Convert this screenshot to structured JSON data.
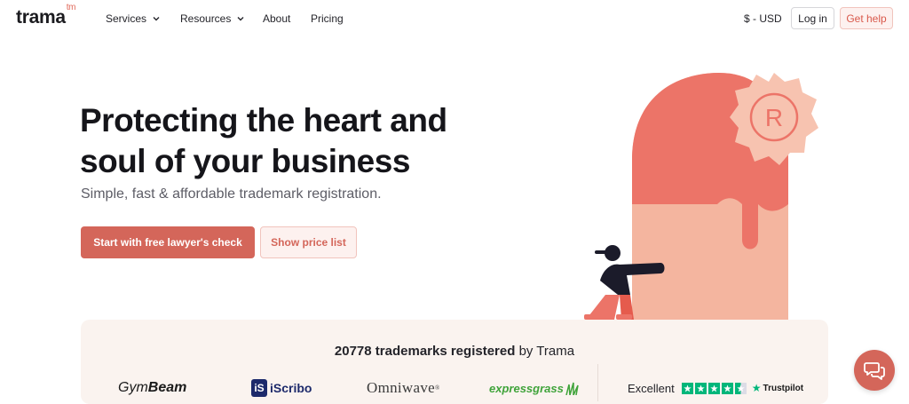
{
  "header": {
    "logo": "trama",
    "logo_sup": "tm",
    "nav": {
      "services": "Services",
      "resources": "Resources",
      "about": "About",
      "pricing": "Pricing"
    },
    "currency": "$ - USD",
    "login_label": "Log in",
    "help_label": "Get help"
  },
  "hero": {
    "title": "Protecting the heart and soul of your business",
    "subtitle": "Simple, fast & affordable trademark registration.",
    "primary_cta": "Start with free lawyer's check",
    "secondary_cta": "Show price list"
  },
  "band": {
    "count": "20778",
    "title_middle": "trademarks registered",
    "title_suffix": "by Trama",
    "logos": {
      "gymbeam_a": "Gym",
      "gymbeam_b": "Beam",
      "iscribo_badge": "iS",
      "iscribo": "iScribo",
      "omniwave": "Omniwave",
      "expressgrass": "expressgrass"
    },
    "trustpilot": {
      "rating_text": "Excellent",
      "brand": "Trustpilot",
      "stars": 4.5
    }
  },
  "colors": {
    "accent": "#d4665a",
    "band_bg": "#faf3ef",
    "trustpilot_green": "#00b67a"
  },
  "icons": {
    "registered": "registered-mark-icon",
    "chat": "chat-bubbles-icon"
  }
}
